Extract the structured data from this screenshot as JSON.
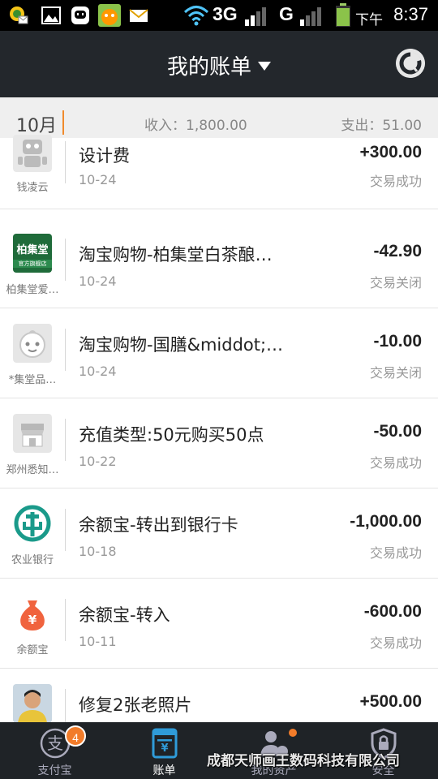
{
  "status_bar": {
    "network_3g": "3G",
    "network_g": "G",
    "ampm": "下午",
    "time": "8:37"
  },
  "header": {
    "title": "我的账单"
  },
  "month_bar": {
    "month": "10月",
    "income": "收入：1,800.00",
    "expense": "支出：51.00"
  },
  "transactions": [
    {
      "merchant": "钱凌云",
      "title": "设计费",
      "date": "10-24",
      "amount": "+300.00",
      "status": "交易成功",
      "icon": "robot-avatar-icon"
    },
    {
      "merchant": "柏集堂爱…",
      "title": "淘宝购物-柏集堂白茶酿…",
      "date": "10-24",
      "amount": "-42.90",
      "status": "交易关闭",
      "icon": "store-logo-icon",
      "logo_text": "柏集堂",
      "logo_sub": "官方旗舰店"
    },
    {
      "merchant": "*集堂品…",
      "title": "淘宝购物-国膳&middot;…",
      "date": "10-24",
      "amount": "-10.00",
      "status": "交易关闭",
      "icon": "face-avatar-icon"
    },
    {
      "merchant": "郑州悉知…",
      "title": "充值类型:50元购买50点",
      "date": "10-22",
      "amount": "-50.00",
      "status": "交易成功",
      "icon": "shop-icon"
    },
    {
      "merchant": "农业银行",
      "title": "余额宝-转出到银行卡",
      "date": "10-18",
      "amount": "-1,000.00",
      "status": "交易成功",
      "icon": "abc-bank-icon"
    },
    {
      "merchant": "余额宝",
      "title": "余额宝-转入",
      "date": "10-11",
      "amount": "-600.00",
      "status": "交易成功",
      "icon": "money-bag-icon"
    },
    {
      "merchant": "",
      "title": "修复2张老照片",
      "date": "",
      "amount": "+500.00",
      "status": "",
      "icon": "photo-avatar-icon"
    }
  ],
  "tabs": [
    {
      "label": "支付宝",
      "badge": "4",
      "icon": "alipay-icon"
    },
    {
      "label": "账单",
      "icon": "bill-icon",
      "active": true
    },
    {
      "label": "我的资产",
      "icon": "assets-icon"
    },
    {
      "label": "安全",
      "icon": "shield-icon"
    }
  ],
  "watermark": "成都天师画王数码科技有限公司",
  "colors": {
    "header_bg": "#23272c",
    "accent": "#f08a2c",
    "tab_active": "#2f9bd8"
  }
}
